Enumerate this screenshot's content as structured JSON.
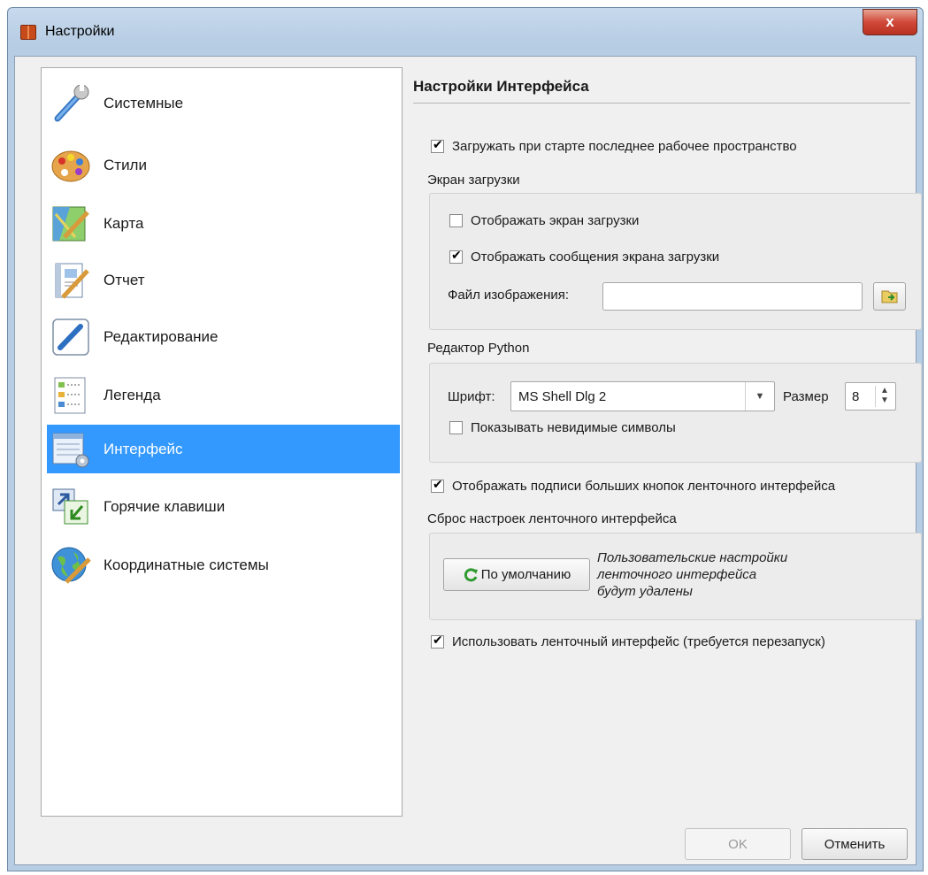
{
  "window": {
    "title": "Настройки",
    "close_glyph": "x"
  },
  "sidebar": {
    "items": [
      {
        "label": "Системные",
        "icon": "wrench-icon"
      },
      {
        "label": "Стили",
        "icon": "palette-icon"
      },
      {
        "label": "Карта",
        "icon": "map-icon"
      },
      {
        "label": "Отчет",
        "icon": "report-icon"
      },
      {
        "label": "Редактирование",
        "icon": "pencil-icon"
      },
      {
        "label": "Легенда",
        "icon": "legend-icon"
      },
      {
        "label": "Интерфейс",
        "icon": "interface-icon",
        "selected": true
      },
      {
        "label": "Горячие клавиши",
        "icon": "shortcut-icon"
      },
      {
        "label": "Координатные системы",
        "icon": "globe-icon"
      }
    ]
  },
  "panel": {
    "title": "Настройки Интерфейса",
    "load_workspace": {
      "label": "Загружать при старте последнее рабочее пространство",
      "checked": true
    },
    "splash_section": {
      "title": "Экран загрузки",
      "show_splash": {
        "label": "Отображать экран загрузки",
        "checked": false
      },
      "show_messages": {
        "label": "Отображать сообщения экрана загрузки",
        "checked": true
      },
      "image_file_label": "Файл изображения:",
      "image_file_value": ""
    },
    "python_section": {
      "title": "Редактор Python",
      "font_label": "Шрифт:",
      "font_value": "MS Shell Dlg 2",
      "size_label": "Размер",
      "size_value": "8",
      "show_invisible": {
        "label": "Показывать невидимые символы",
        "checked": false
      }
    },
    "ribbon_captions": {
      "label": "Отображать подписи больших кнопок ленточного интерфейса",
      "checked": true
    },
    "ribbon_reset": {
      "title": "Сброс настроек ленточного интерфейса",
      "button_label": "По умолчанию",
      "note_lines": [
        "Пользовательские настройки",
        "ленточного интерфейса",
        "будут удалены"
      ]
    },
    "use_ribbon": {
      "label": "Использовать ленточный интерфейс (требуется перезапуск)",
      "checked": true
    }
  },
  "footer": {
    "ok_label": "OK",
    "cancel_label": "Отменить"
  },
  "colors": {
    "selection": "#3399ff",
    "title_bar": "#b7cde4",
    "close_button": "#d0493a"
  }
}
